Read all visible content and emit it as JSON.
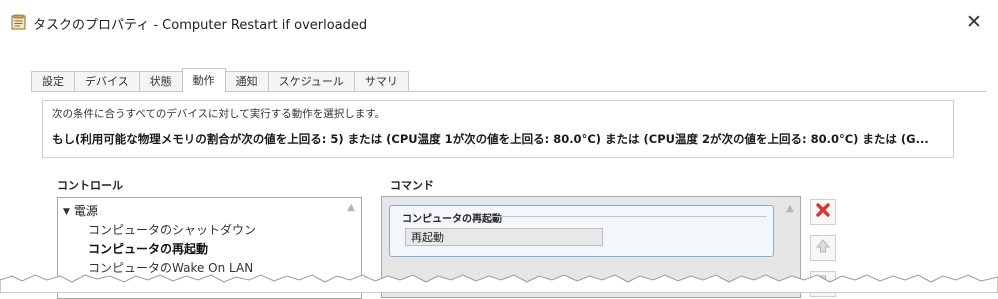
{
  "window": {
    "title": "タスクのプロパティ - Computer Restart if overloaded",
    "close_glyph": "✕"
  },
  "tabs": [
    {
      "label": "設定",
      "active": false
    },
    {
      "label": "デバイス",
      "active": false
    },
    {
      "label": "状態",
      "active": false
    },
    {
      "label": "動作",
      "active": true
    },
    {
      "label": "通知",
      "active": false
    },
    {
      "label": "スケジュール",
      "active": false
    },
    {
      "label": "サマリ",
      "active": false
    }
  ],
  "info": {
    "instruction": "次の条件に合うすべてのデバイスに対して実行する動作を選択します。",
    "condition": "もし(利用可能な物理メモリの割合が次の値を上回る: 5) または (CPU温度 1が次の値を上回る: 80.0°C) または (CPU温度 2が次の値を上回る: 80.0°C) または (G..."
  },
  "control": {
    "label": "コントロール",
    "root": "電源",
    "items": [
      {
        "label": "コンピュータのシャットダウン",
        "selected": false
      },
      {
        "label": "コンピュータの再起動",
        "selected": true
      },
      {
        "label": "コンピュータのWake On LAN",
        "selected": false
      }
    ]
  },
  "command": {
    "label": "コマンド",
    "card_title": "コンピュータの再起動",
    "field_value": "再起動"
  },
  "icons": {
    "title": "properties-icon",
    "delete": "red-x-icon",
    "up": "arrow-up-icon",
    "down": "arrow-down-icon"
  },
  "colors": {
    "delete_red": "#d9352b",
    "card_border": "#88acd6",
    "command_bg": "#e6e6e6"
  }
}
